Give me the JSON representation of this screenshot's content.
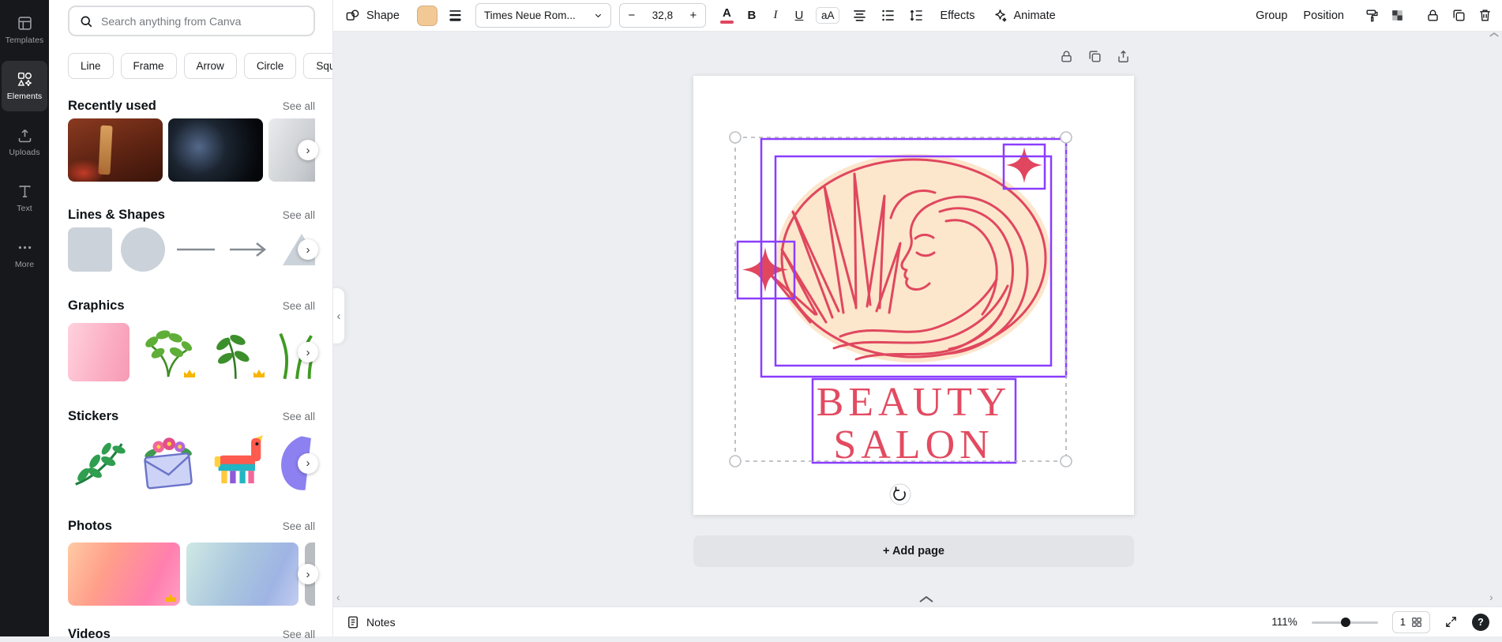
{
  "colors": {
    "accent": "#8b3dff",
    "art": "#e0475f",
    "peach": "#fce6cc",
    "shape_fill": "#f2c894"
  },
  "rail": {
    "items": [
      {
        "label": "Templates"
      },
      {
        "label": "Elements"
      },
      {
        "label": "Uploads"
      },
      {
        "label": "Text"
      },
      {
        "label": "More"
      }
    ]
  },
  "sidebar": {
    "search_placeholder": "Search anything from Canva",
    "chips": [
      "Line",
      "Frame",
      "Arrow",
      "Circle",
      "Square"
    ],
    "sections": {
      "recent": {
        "title": "Recently used",
        "link": "See all"
      },
      "shapes": {
        "title": "Lines & Shapes",
        "link": "See all"
      },
      "graphics": {
        "title": "Graphics",
        "link": "See all"
      },
      "stickers": {
        "title": "Stickers",
        "link": "See all"
      },
      "photos": {
        "title": "Photos",
        "link": "See all"
      },
      "videos": {
        "title": "Videos",
        "link": "See all"
      }
    }
  },
  "toolbar": {
    "shape": "Shape",
    "font": "Times Neue Rom...",
    "size": "32,8",
    "decrease": "−",
    "increase": "+",
    "color_letter": "A",
    "bold": "B",
    "italic": "I",
    "underline": "U",
    "case": "aA",
    "effects": "Effects",
    "animate": "Animate",
    "group": "Group",
    "position": "Position"
  },
  "design": {
    "title_line1": "BEAUTY",
    "title_line2": "SALON"
  },
  "canvas": {
    "add_page": "+ Add page"
  },
  "statusbar": {
    "notes": "Notes",
    "zoom": "111%",
    "page": "1",
    "help": "?"
  }
}
